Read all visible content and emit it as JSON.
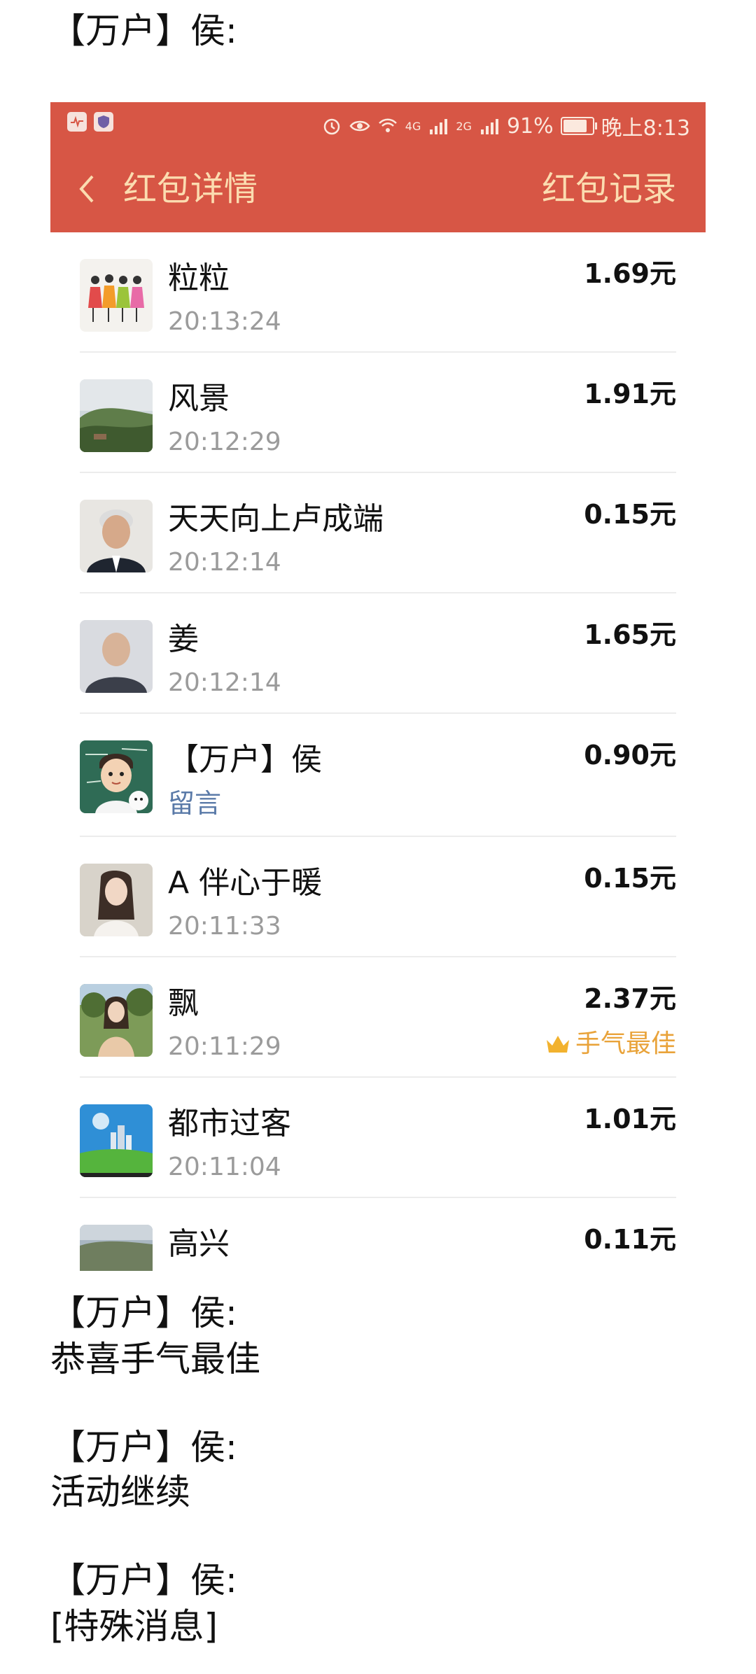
{
  "chat": {
    "sender": "【万户】侯:",
    "messages": [
      {
        "author": "【万户】侯:",
        "text": "恭喜手气最佳"
      },
      {
        "author": "【万户】侯:",
        "text": "活动继续"
      },
      {
        "author": "【万户】侯:",
        "text": "[特殊消息]"
      }
    ]
  },
  "screenshot": {
    "status_bar": {
      "network_4g": "4G",
      "network_2g": "2G",
      "battery": "91%",
      "battery_level": 0.91,
      "time": "晚上8:13"
    },
    "nav": {
      "title": "红包详情",
      "record": "红包记录"
    },
    "records": [
      {
        "name": "粒粒",
        "time": "20:13:24",
        "amount": "1.69元"
      },
      {
        "name": "风景",
        "time": "20:12:29",
        "amount": "1.91元"
      },
      {
        "name": "天天向上卢成端",
        "time": "20:12:14",
        "amount": "0.15元"
      },
      {
        "name": "姜",
        "time": "20:12:14",
        "amount": "1.65元"
      },
      {
        "name": "【万户】侯",
        "note": "留言",
        "amount": "0.90元"
      },
      {
        "name": "A 伴心于暖",
        "time": "20:11:33",
        "amount": "0.15元"
      },
      {
        "name": "飘",
        "time": "20:11:29",
        "amount": "2.37元",
        "badge": "手气最佳"
      },
      {
        "name": "都市过客",
        "time": "20:11:04",
        "amount": "1.01元"
      },
      {
        "name": "高兴",
        "amount": "0.11元"
      }
    ],
    "colors": {
      "header_bg": "#d75645",
      "header_text": "#fbdcb0",
      "best_badge": "#e9a33a",
      "note_link": "#5a7aa8"
    }
  }
}
